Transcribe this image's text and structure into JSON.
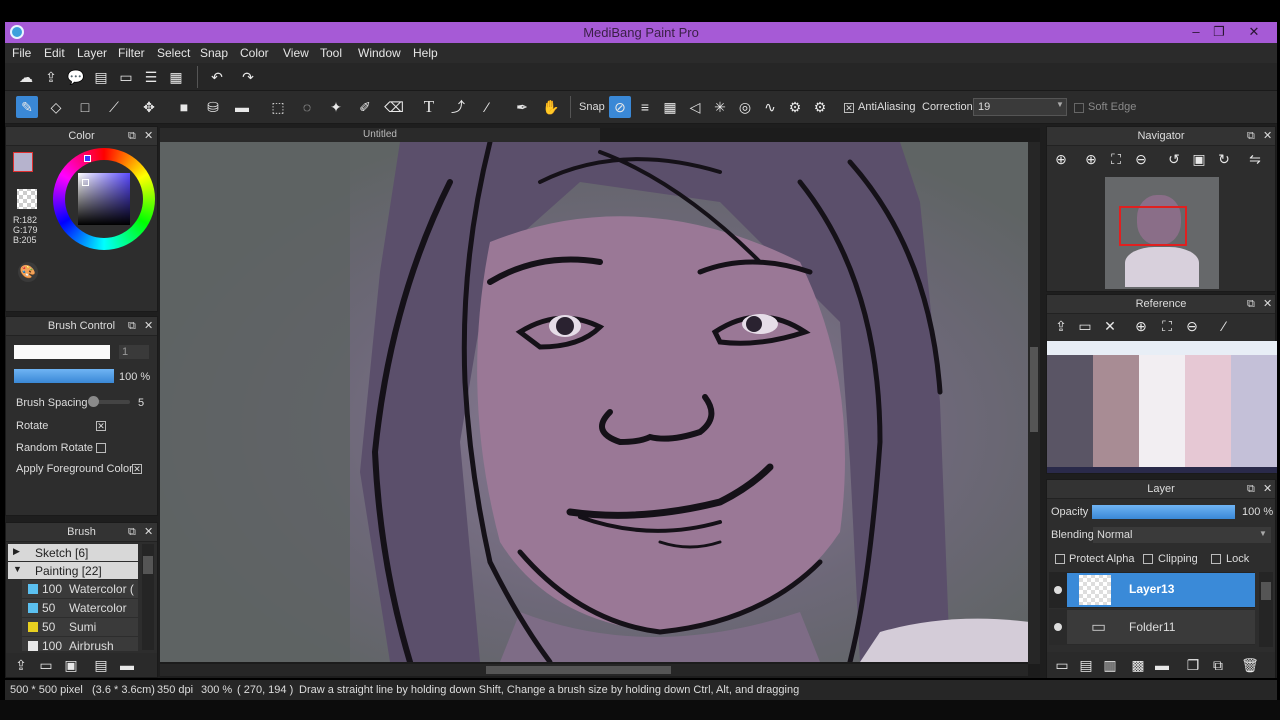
{
  "window": {
    "title": "MediBang Paint Pro",
    "minimize": "–",
    "restore": "❐",
    "close": "✕"
  },
  "menu": [
    "File",
    "Edit",
    "Layer",
    "Filter",
    "Select",
    "Snap",
    "Color",
    "View",
    "Tool",
    "Window",
    "Help"
  ],
  "toolbar2": {
    "snap_label": "Snap",
    "antialiasing_label": "AntiAliasing",
    "correction_label": "Correction",
    "correction_value": "19",
    "soft_edge_label": "Soft Edge"
  },
  "color_panel": {
    "title": "Color",
    "foreground_color": "#b6b3cd",
    "rgb": [
      "R:182",
      "G:179",
      "B:205"
    ]
  },
  "brush_control": {
    "title": "Brush Control",
    "size_value": "1",
    "opacity_value": "100 %",
    "brush_spacing_label": "Brush Spacing",
    "brush_spacing_value": "5",
    "rotate_label": "Rotate",
    "random_rotate_label": "Random Rotate",
    "apply_fg_label": "Apply Foreground Color"
  },
  "brush_panel": {
    "title": "Brush",
    "groups": [
      {
        "arrow": "▶",
        "label": "Sketch [6]"
      },
      {
        "arrow": "▼",
        "label": "Painting [22]"
      }
    ],
    "items": [
      {
        "size": "100",
        "name": "Watercolor (",
        "color": "#5bc0f0"
      },
      {
        "size": "50",
        "name": "Watercolor",
        "color": "#5bc0f0"
      },
      {
        "size": "50",
        "name": "Sumi",
        "color": "#e8d020"
      },
      {
        "size": "100",
        "name": "Airbrush",
        "color": "#e8e8e8"
      }
    ]
  },
  "canvas": {
    "document_title": "Untitled"
  },
  "navigator": {
    "title": "Navigator"
  },
  "reference": {
    "title": "Reference",
    "swatches": [
      "#5a5565",
      "#a88c94",
      "#f2eef2",
      "#e6c8d4",
      "#c4c0d8"
    ]
  },
  "layer_panel": {
    "title": "Layer",
    "opacity_label": "Opacity",
    "opacity_value": "100 %",
    "blending_label": "Blending",
    "blending_value": "Normal",
    "protect_alpha_label": "Protect Alpha",
    "clipping_label": "Clipping",
    "lock_label": "Lock",
    "layers": [
      {
        "name": "Layer13",
        "selected": true
      },
      {
        "name": "Folder11",
        "selected": false
      }
    ]
  },
  "status": {
    "size": "500 * 500 pixel",
    "cm": "(3.6 * 3.6cm)",
    "dpi": "350 dpi",
    "zoom": "300 %",
    "coords": "( 270, 194 )",
    "hint": "Draw a straight line by holding down Shift, Change a brush size by holding down Ctrl, Alt, and dragging"
  },
  "colors": {
    "accent": "#3a88d6",
    "titlebar": "#a65ad6",
    "selected_layer": "#3a8ad8"
  }
}
